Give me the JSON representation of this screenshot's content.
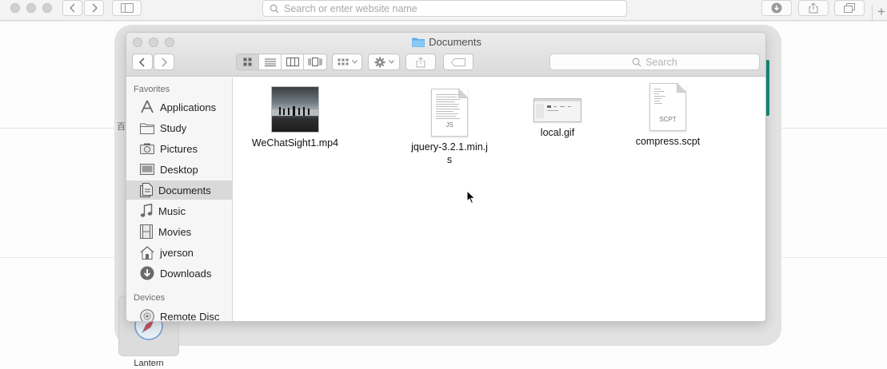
{
  "browser": {
    "url_placeholder": "Search or enter website name",
    "new_tab_label": "+"
  },
  "background": {
    "stray_char": "百",
    "dock_app_label": "Lantern"
  },
  "finder": {
    "title": "Documents",
    "search_placeholder": "Search",
    "sidebar": {
      "favorites_header": "Favorites",
      "favorites": [
        {
          "label": "Applications",
          "icon": "applications-icon"
        },
        {
          "label": "Study",
          "icon": "folder-icon"
        },
        {
          "label": "Pictures",
          "icon": "camera-icon"
        },
        {
          "label": "Desktop",
          "icon": "desktop-icon"
        },
        {
          "label": "Documents",
          "icon": "documents-icon",
          "selected": true
        },
        {
          "label": "Music",
          "icon": "music-note-icon"
        },
        {
          "label": "Movies",
          "icon": "film-icon"
        },
        {
          "label": "jverson",
          "icon": "home-icon"
        },
        {
          "label": "Downloads",
          "icon": "download-icon"
        }
      ],
      "devices_header": "Devices",
      "devices": [
        {
          "label": "Remote Disc",
          "icon": "disc-icon"
        }
      ]
    },
    "files": [
      {
        "name": "WeChatSight1.mp4",
        "kind": "video"
      },
      {
        "name": "jquery-3.2.1.min.js",
        "kind": "document",
        "tag": "JS"
      },
      {
        "name": "local.gif",
        "kind": "image"
      },
      {
        "name": "compress.scpt",
        "kind": "document",
        "tag": "SCPT"
      }
    ]
  },
  "colors": {
    "selection": "#d9d9d9",
    "folder_blue": "#5fb1f0",
    "accent_teal": "#1a8a7c"
  }
}
